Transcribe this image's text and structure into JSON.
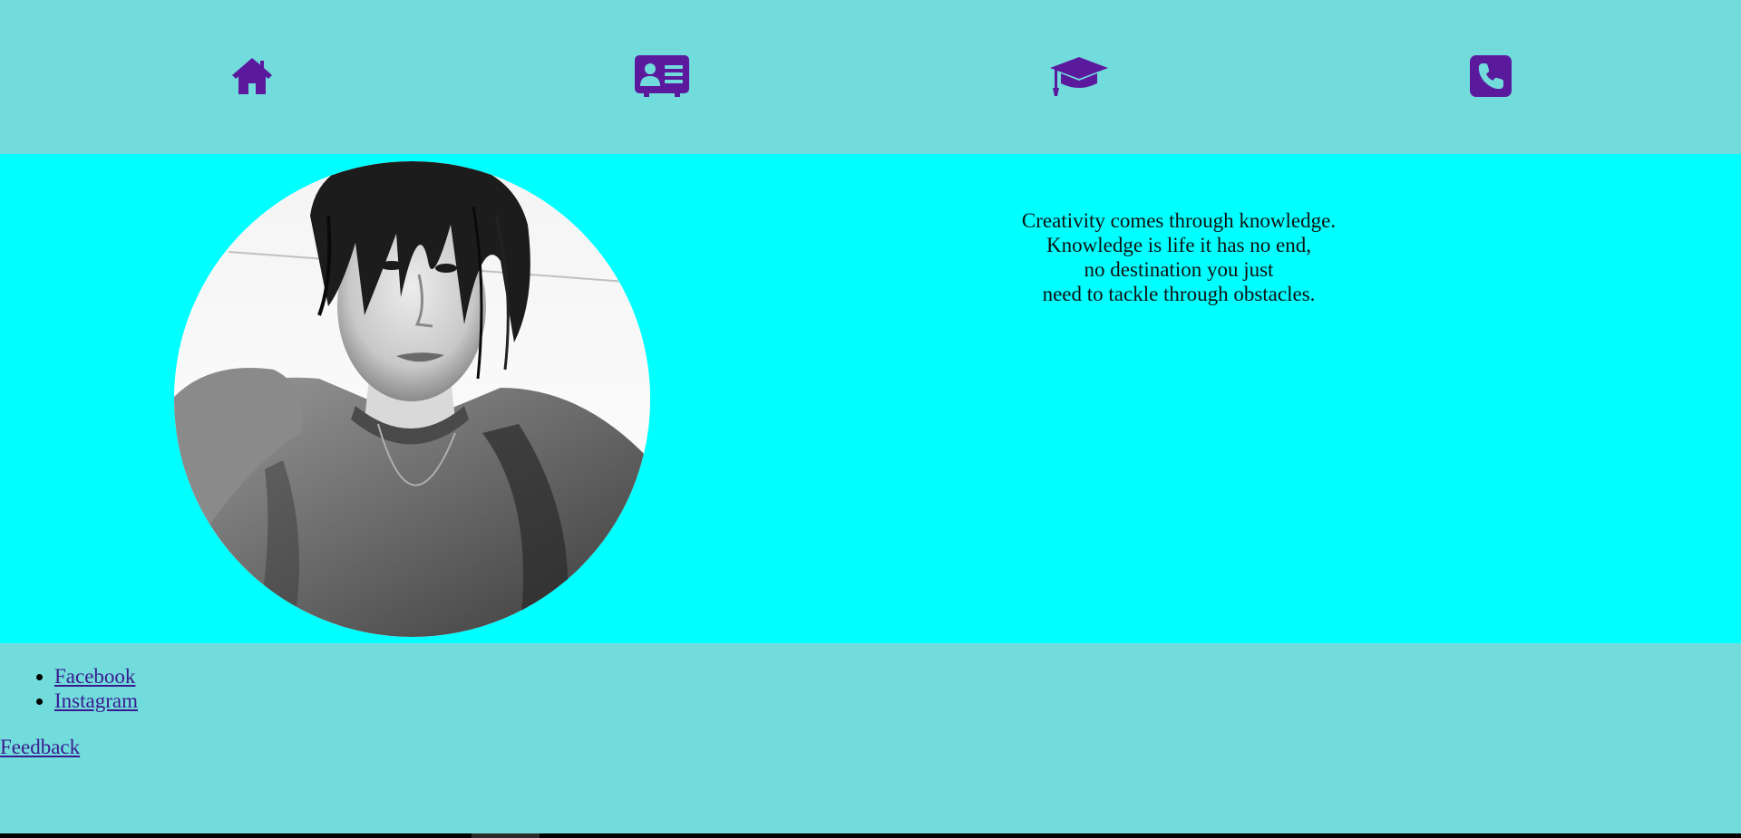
{
  "nav": {
    "items": [
      {
        "icon": "home-icon",
        "color": "#5b1a9e"
      },
      {
        "icon": "id-card-icon",
        "color": "#5b1a9e"
      },
      {
        "icon": "graduation-cap-icon",
        "color": "#5b1a9e"
      },
      {
        "icon": "phone-icon",
        "color": "#5b1a9e"
      }
    ]
  },
  "hero": {
    "quote_lines": [
      "Creativity comes through knowledge.",
      "Knowledge is life it has no end,",
      "no destination you just",
      "need to tackle through obstacles."
    ]
  },
  "footer": {
    "social_links": [
      {
        "label": "Facebook"
      },
      {
        "label": "Instagram"
      }
    ],
    "feedback_label": "Feedback"
  },
  "colors": {
    "header_bg": "#72dcdc",
    "hero_bg": "#00ffff",
    "icon": "#5b1a9e",
    "link": "#3a1a8f"
  }
}
